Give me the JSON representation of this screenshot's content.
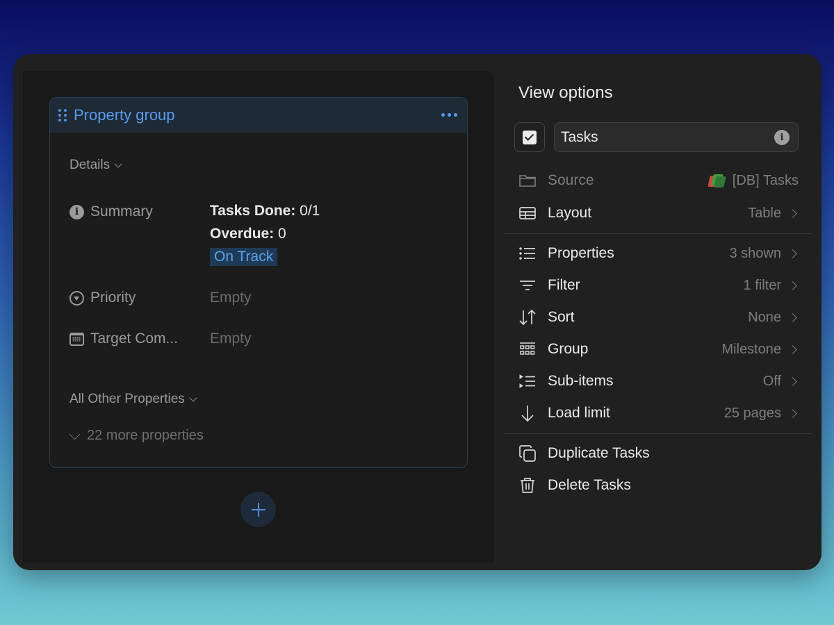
{
  "card": {
    "title": "Property group",
    "details_label": "Details",
    "summary": {
      "name": "Summary",
      "tasks_done_label": "Tasks Done:",
      "tasks_done_value": "0/1",
      "overdue_label": "Overdue:",
      "overdue_value": "0",
      "status_badge": "On Track"
    },
    "properties": [
      {
        "name": "Priority",
        "value": "Empty"
      },
      {
        "name": "Target Com...",
        "value": "Empty"
      }
    ],
    "other_label": "All Other Properties",
    "more_label": "22 more properties"
  },
  "view_options": {
    "title": "View options",
    "name_value": "Tasks",
    "source": {
      "label": "Source",
      "value": "[DB] Tasks"
    },
    "layout": {
      "label": "Layout",
      "value": "Table"
    },
    "properties": {
      "label": "Properties",
      "value": "3 shown"
    },
    "filter": {
      "label": "Filter",
      "value": "1 filter"
    },
    "sort": {
      "label": "Sort",
      "value": "None"
    },
    "group": {
      "label": "Group",
      "value": "Milestone"
    },
    "subitems": {
      "label": "Sub-items",
      "value": "Off"
    },
    "load_limit": {
      "label": "Load limit",
      "value": "25 pages"
    },
    "duplicate_label": "Duplicate Tasks",
    "delete_label": "Delete Tasks"
  },
  "colors": {
    "accent": "#5a9bef",
    "panel": "#202020",
    "card": "#1c1c1c"
  }
}
